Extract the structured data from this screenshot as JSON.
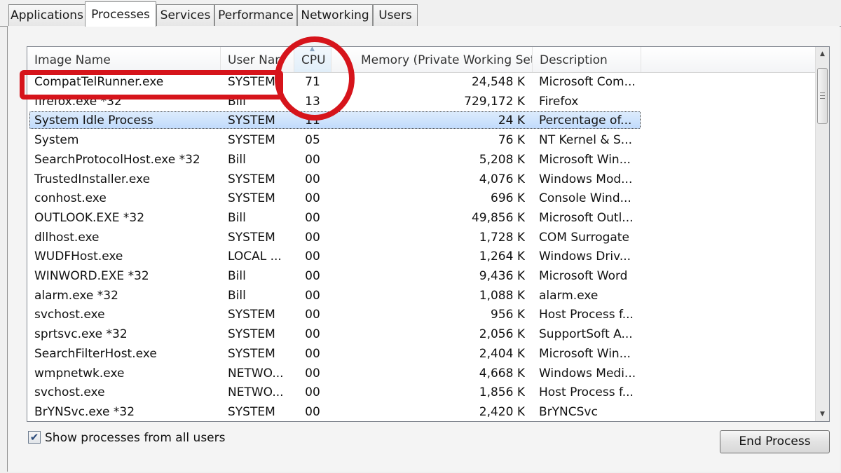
{
  "tabs": [
    {
      "label": "Applications"
    },
    {
      "label": "Processes"
    },
    {
      "label": "Services"
    },
    {
      "label": "Performance"
    },
    {
      "label": "Networking"
    },
    {
      "label": "Users"
    }
  ],
  "table": {
    "columns": {
      "image_name": "Image Name",
      "user_name": "User Nar",
      "cpu": "CPU",
      "memory": "Memory (Private Working Set)",
      "description": "Description"
    },
    "rows": [
      {
        "name": "CompatTelRunner.exe",
        "user": "SYSTEM",
        "cpu": "71",
        "mem": "24,548 K",
        "desc": "Microsoft Com..."
      },
      {
        "name": "firefox.exe *32",
        "user": "Bill",
        "cpu": "13",
        "mem": "729,172 K",
        "desc": "Firefox"
      },
      {
        "name": "System Idle Process",
        "user": "SYSTEM",
        "cpu": "11",
        "mem": "24 K",
        "desc": "Percentage of..."
      },
      {
        "name": "System",
        "user": "SYSTEM",
        "cpu": "05",
        "mem": "76 K",
        "desc": "NT Kernel & S..."
      },
      {
        "name": "SearchProtocolHost.exe *32",
        "user": "Bill",
        "cpu": "00",
        "mem": "5,208 K",
        "desc": "Microsoft Win..."
      },
      {
        "name": "TrustedInstaller.exe",
        "user": "SYSTEM",
        "cpu": "00",
        "mem": "4,076 K",
        "desc": "Windows Mod..."
      },
      {
        "name": "conhost.exe",
        "user": "SYSTEM",
        "cpu": "00",
        "mem": "696 K",
        "desc": "Console Wind..."
      },
      {
        "name": "OUTLOOK.EXE *32",
        "user": "Bill",
        "cpu": "00",
        "mem": "49,856 K",
        "desc": "Microsoft Outl..."
      },
      {
        "name": "dllhost.exe",
        "user": "SYSTEM",
        "cpu": "00",
        "mem": "1,728 K",
        "desc": "COM Surrogate"
      },
      {
        "name": "WUDFHost.exe",
        "user": "LOCAL ...",
        "cpu": "00",
        "mem": "1,264 K",
        "desc": "Windows Driv..."
      },
      {
        "name": "WINWORD.EXE *32",
        "user": "Bill",
        "cpu": "00",
        "mem": "9,436 K",
        "desc": "Microsoft Word"
      },
      {
        "name": "alarm.exe *32",
        "user": "Bill",
        "cpu": "00",
        "mem": "1,088 K",
        "desc": "alarm.exe"
      },
      {
        "name": "svchost.exe",
        "user": "SYSTEM",
        "cpu": "00",
        "mem": "956 K",
        "desc": "Host Process f..."
      },
      {
        "name": "sprtsvc.exe *32",
        "user": "SYSTEM",
        "cpu": "00",
        "mem": "2,056 K",
        "desc": "SupportSoft A..."
      },
      {
        "name": "SearchFilterHost.exe",
        "user": "SYSTEM",
        "cpu": "00",
        "mem": "2,404 K",
        "desc": "Microsoft Win..."
      },
      {
        "name": "wmpnetwk.exe",
        "user": "NETWO...",
        "cpu": "00",
        "mem": "4,668 K",
        "desc": "Windows Medi..."
      },
      {
        "name": "svchost.exe",
        "user": "NETWO...",
        "cpu": "00",
        "mem": "1,856 K",
        "desc": "Host Process f..."
      },
      {
        "name": "BrYNSvc.exe *32",
        "user": "SYSTEM",
        "cpu": "00",
        "mem": "2,420 K",
        "desc": "BrYNCSvc"
      }
    ]
  },
  "footer": {
    "show_all_label": "Show processes from all users",
    "show_all_checked": true,
    "end_process_label": "End Process"
  },
  "annotation_color": "#d6141b",
  "icons": {
    "sort": "sort-up-icon",
    "scroll_up": "arrow-up-icon",
    "scroll_down": "arrow-down-icon",
    "check": "checkmark-icon"
  }
}
